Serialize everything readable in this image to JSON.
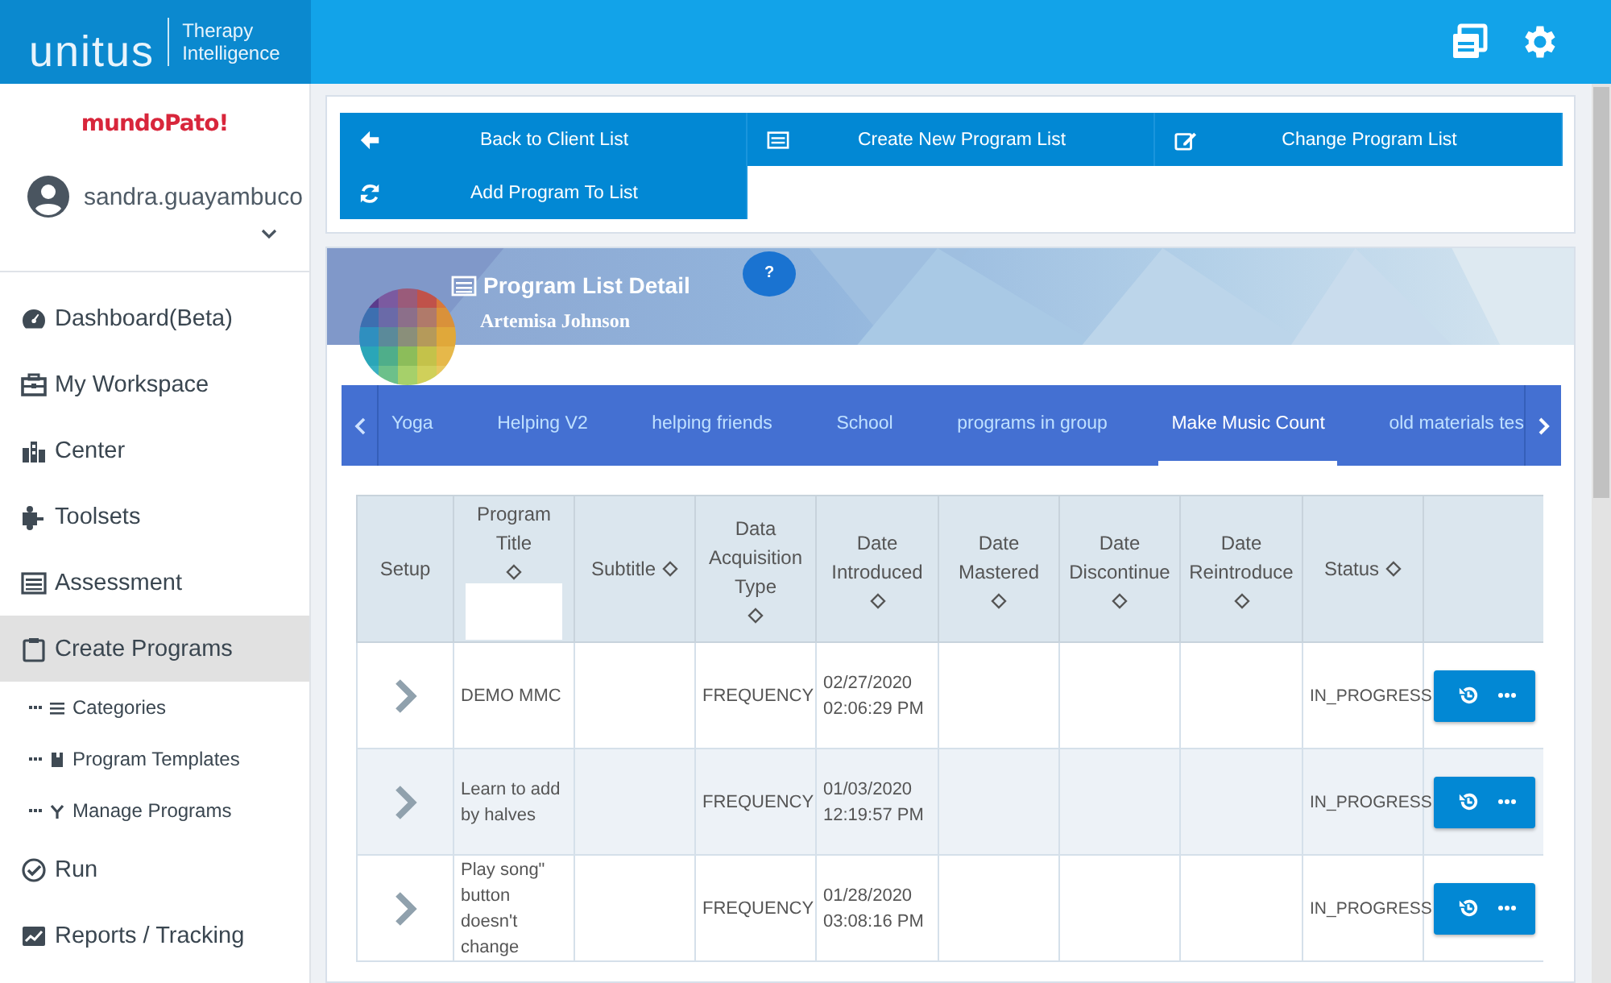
{
  "header": {
    "logo_name": "unitus",
    "logo_line_1": "Therapy",
    "logo_line_2": "Intelligence"
  },
  "sidebar": {
    "brand": "mundoPato!",
    "user": "sandra.guayambuco",
    "items": [
      {
        "label": "Dashboard(Beta)",
        "selected": false
      },
      {
        "label": "My Workspace",
        "selected": false
      },
      {
        "label": "Center",
        "selected": false
      },
      {
        "label": "Toolsets",
        "selected": false
      },
      {
        "label": "Assessment",
        "selected": false
      },
      {
        "label": "Create Programs",
        "selected": true,
        "children": [
          {
            "label": "Categories",
            "selected": false
          },
          {
            "label": "Program Templates",
            "selected": false
          },
          {
            "label": "Manage Programs",
            "selected": false
          }
        ]
      },
      {
        "label": "Run",
        "selected": false
      },
      {
        "label": "Reports / Tracking",
        "selected": false
      }
    ]
  },
  "actions": [
    "Back to Client List",
    "Create New Program List",
    "Change Program List",
    "Add Program To List"
  ],
  "detail": {
    "title": "Program List Detail",
    "client": "Artemisa Johnson",
    "help": "?"
  },
  "tabs": [
    {
      "label": "Yoga",
      "selected": false
    },
    {
      "label": "Helping V2",
      "selected": false
    },
    {
      "label": "helping friends",
      "selected": false
    },
    {
      "label": "School",
      "selected": false
    },
    {
      "label": "programs in group",
      "selected": false
    },
    {
      "label": "Make Music Count",
      "selected": true
    },
    {
      "label": "old materials tes",
      "selected": false
    }
  ],
  "table": {
    "columns": [
      {
        "label": "Setup",
        "sortable": false
      },
      {
        "label": "Program Title",
        "sortable": true,
        "filter": true
      },
      {
        "label": "Subtitle",
        "sortable": true
      },
      {
        "label": "Data Acquisition Type",
        "sortable": true
      },
      {
        "label": "Date Introduced",
        "sortable": true
      },
      {
        "label": "Date Mastered",
        "sortable": true
      },
      {
        "label": "Date Discontinue",
        "sortable": true
      },
      {
        "label": "Date Reintroduce",
        "sortable": true
      },
      {
        "label": "Status",
        "sortable": true
      }
    ],
    "rows": [
      {
        "title": "DEMO MMC",
        "acquisition_type": "FREQUENCY",
        "date_introduced": "02/27/2020 02:06:29 PM",
        "status": "IN_PROGRESS"
      },
      {
        "title": "Learn to add by halves",
        "acquisition_type": "FREQUENCY",
        "date_introduced": "01/03/2020 12:19:57 PM",
        "status": "IN_PROGRESS"
      },
      {
        "title": "Play song\" button doesn't change",
        "acquisition_type": "FREQUENCY",
        "date_introduced": "01/28/2020 03:08:16 PM",
        "status": "IN_PROGRESS"
      }
    ]
  }
}
